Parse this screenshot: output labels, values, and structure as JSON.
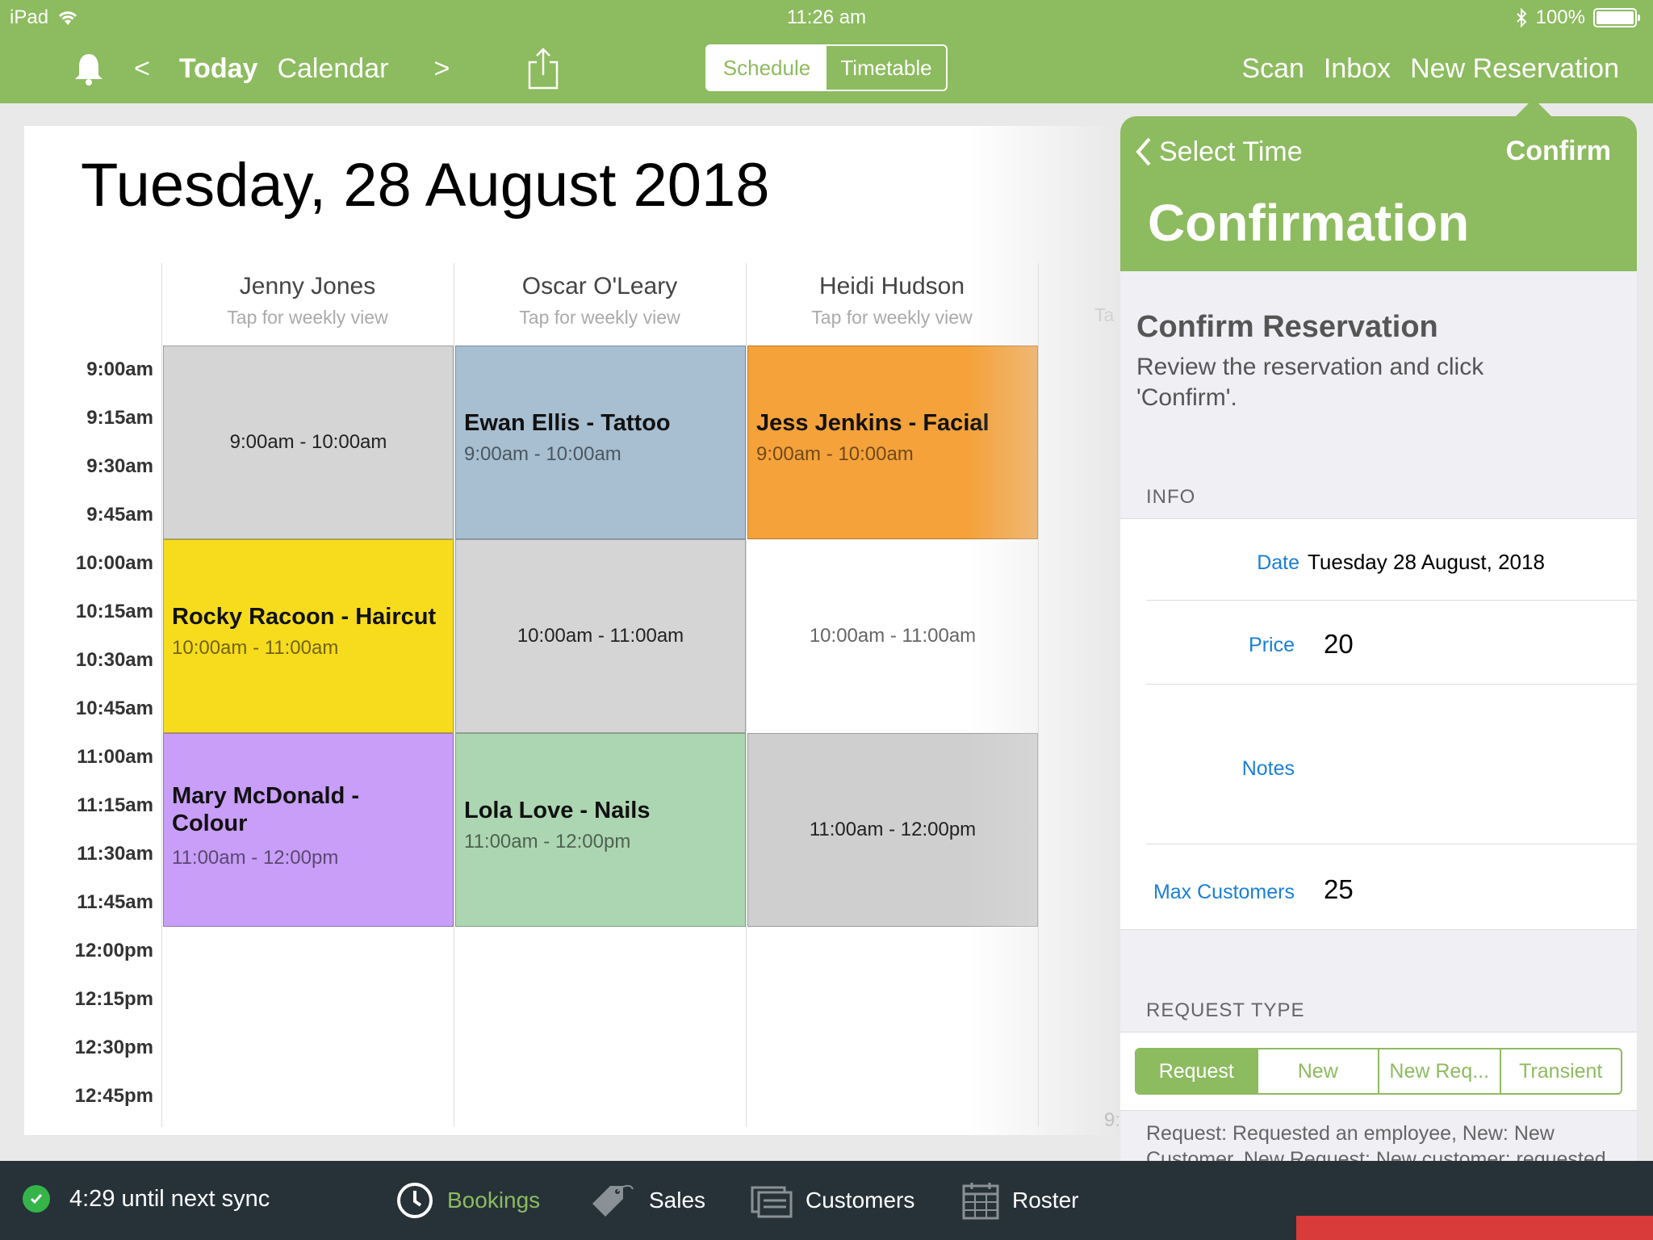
{
  "status_bar": {
    "device": "iPad",
    "time": "11:26 am",
    "battery": "100%"
  },
  "toolbar": {
    "prev": "<",
    "today": "Today",
    "calendar": "Calendar",
    "next": ">",
    "view_toggle": [
      {
        "label": "Schedule",
        "active": true
      },
      {
        "label": "Timetable",
        "active": false
      }
    ],
    "scan": "Scan",
    "inbox": "Inbox",
    "new_reservation": "New Reservation"
  },
  "calendar": {
    "date_title": "Tuesday, 28 August 2018",
    "times": [
      "9:00am",
      "9:15am",
      "9:30am",
      "9:45am",
      "10:00am",
      "10:15am",
      "10:30am",
      "10:45am",
      "11:00am",
      "11:15am",
      "11:30am",
      "11:45am",
      "12:00pm",
      "12:15pm",
      "12:30pm",
      "12:45pm"
    ],
    "columns": [
      {
        "name": "Jenny Jones",
        "sub": "Tap for weekly view"
      },
      {
        "name": "Oscar O'Leary",
        "sub": "Tap for weekly view"
      },
      {
        "name": "Heidi Hudson",
        "sub": "Tap for weekly view"
      }
    ],
    "next_column_peek": "Ta",
    "bottom_peek": "9:",
    "slots": {
      "jj_1": {
        "time": "9:00am - 10:00am"
      },
      "jj_2": {
        "title": "Rocky Racoon - Haircut",
        "time": "10:00am - 11:00am"
      },
      "jj_3": {
        "title": "Mary McDonald - Colour",
        "time": "11:00am - 12:00pm"
      },
      "oo_1": {
        "title": "Ewan Ellis - Tattoo",
        "time": "9:00am - 10:00am"
      },
      "oo_2": {
        "time": "10:00am - 11:00am"
      },
      "oo_3": {
        "title": "Lola Love - Nails",
        "time": "11:00am - 12:00pm"
      },
      "hh_1": {
        "title": "Jess Jenkins - Facial",
        "time": "9:00am - 10:00am"
      },
      "hh_2": {
        "time": "10:00am - 11:00am"
      },
      "hh_3": {
        "time": "11:00am - 12:00pm"
      }
    },
    "colors": {
      "grey": "#d5d5d5",
      "blue": "#a7bfd1",
      "orange": "#f5a23a",
      "yellow": "#f7dc1d",
      "purple": "#c89ef8",
      "green": "#acd6b2"
    }
  },
  "popover": {
    "back": "Select Time",
    "confirm": "Confirm",
    "title": "Confirmation",
    "heading": "Confirm Reservation",
    "description": "Review the reservation and click 'Confirm'.",
    "info_label": "INFO",
    "fields": {
      "date_label": "Date",
      "date_value": "Tuesday 28 August, 2018",
      "price_label": "Price",
      "price_value": "20",
      "notes_label": "Notes",
      "max_label": "Max Customers",
      "max_value": "25"
    },
    "request_type_label": "REQUEST TYPE",
    "request_types": [
      {
        "label": "Request",
        "active": true
      },
      {
        "label": "New",
        "active": false
      },
      {
        "label": "New Req...",
        "active": false
      },
      {
        "label": "Transient",
        "active": false
      }
    ],
    "request_desc": "Request: Requested an employee, New: New Customer, New Request: New customer; requested an employee, Transient: Customer doesn't mind which employee.",
    "accent": "#8dbb5f"
  },
  "bottom_bar": {
    "sync": "4:29 until next sync",
    "tabs": [
      {
        "label": "Bookings",
        "icon": "clock-icon",
        "active": true
      },
      {
        "label": "Sales",
        "icon": "price-tag-icon",
        "active": false
      },
      {
        "label": "Customers",
        "icon": "customers-icon",
        "active": false
      },
      {
        "label": "Roster",
        "icon": "calendar-grid-icon",
        "active": false
      }
    ]
  }
}
